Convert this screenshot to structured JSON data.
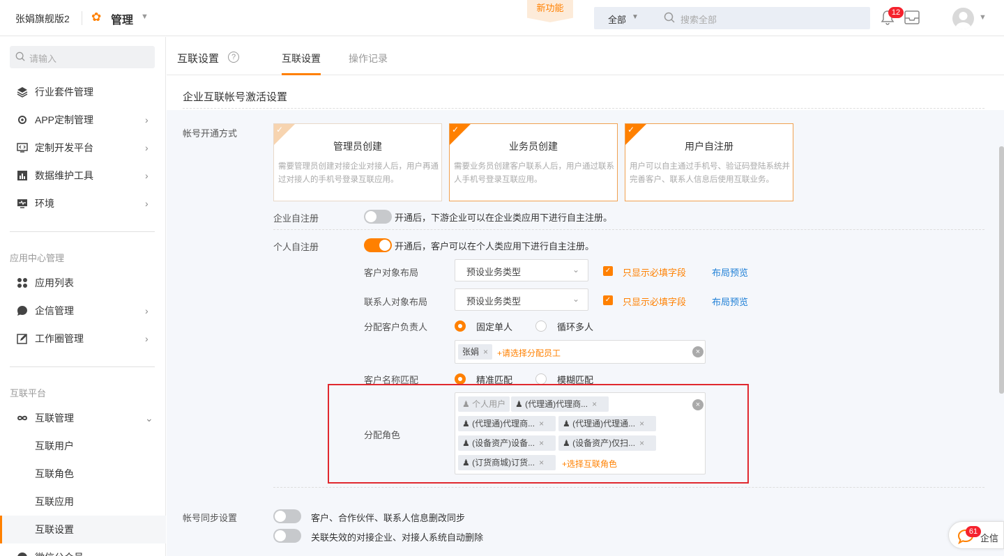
{
  "topbar": {
    "company": "张娟旗舰版2",
    "module": "管理",
    "new_feature": "新功能",
    "search_scope": "全部",
    "search_placeholder": "搜索全部",
    "bell_count": "12"
  },
  "sidebar": {
    "search_placeholder": "请输入",
    "items": [
      {
        "label": "行业套件管理",
        "icon": "layers-icon"
      },
      {
        "label": "APP定制管理",
        "icon": "app-gear-icon"
      },
      {
        "label": "定制开发平台",
        "icon": "code-icon"
      },
      {
        "label": "数据维护工具",
        "icon": "bar-chart-icon"
      },
      {
        "label": "环境",
        "icon": "monitor-icon"
      }
    ],
    "group_app": "应用中心管理",
    "app_items": [
      {
        "label": "应用列表",
        "icon": "grid-icon"
      },
      {
        "label": "企信管理",
        "icon": "chat-icon"
      },
      {
        "label": "工作圈管理",
        "icon": "edit-icon"
      }
    ],
    "group_link": "互联平台",
    "link_parent": "互联管理",
    "link_children": [
      "互联用户",
      "互联角色",
      "互联应用",
      "互联设置"
    ],
    "cutoff_item": "微信公众号"
  },
  "content": {
    "page_title": "互联设置",
    "tabs": [
      "互联设置",
      "操作记录"
    ],
    "section_title": "企业互联帐号激活设置",
    "account_mode_label": "帐号开通方式",
    "cards": [
      {
        "title": "管理员创建",
        "desc": "需要管理员创建对接企业对接人后，用户再通过对接人的手机号登录互联应用。",
        "checked": false
      },
      {
        "title": "业务员创建",
        "desc": "需要业务员创建客户联系人后，用户通过联系人手机号登录互联应用。",
        "checked": true
      },
      {
        "title": "用户自注册",
        "desc": "用户可以自主通过手机号、验证码登陆系统并完善客户、联系人信息后使用互联业务。",
        "checked": true
      }
    ],
    "ent_self_reg": {
      "label": "企业自注册",
      "text": "开通后，下游企业可以在企业类应用下进行自主注册。",
      "on": false
    },
    "personal_self_reg": {
      "label": "个人自注册",
      "text": "开通后，客户可以在个人类应用下进行自主注册。",
      "on": true
    },
    "customer_layout": {
      "label": "客户对象布局",
      "value": "预设业务类型",
      "check": "只显示必填字段",
      "link": "布局预览"
    },
    "contact_layout": {
      "label": "联系人对象布局",
      "value": "预设业务类型",
      "check": "只显示必填字段",
      "link": "布局预览"
    },
    "owner": {
      "label": "分配客户负责人",
      "options": [
        "固定单人",
        "循环多人"
      ],
      "selected": 0,
      "tag": "张娟",
      "add": "+请选择分配员工"
    },
    "name_match": {
      "label": "客户名称匹配",
      "options": [
        "精准匹配",
        "模糊匹配"
      ],
      "selected": 0
    },
    "roles": {
      "label": "分配角色",
      "tags": [
        "个人用户",
        "(代理通)代理商...",
        "(代理通)代理商...",
        "(代理通)代理通...",
        "(设备资产)设备...",
        "(设备资产)仅扫...",
        "(订货商城)订货..."
      ],
      "add": "+选择互联角色"
    },
    "sync_label": "帐号同步设置",
    "sync_items": [
      "客户、合作伙伴、联系人信息删改同步",
      "关联失效的对接企业、对接人系统自动删除"
    ]
  },
  "float": {
    "count": "61",
    "label": "企信"
  },
  "colors": {
    "accent": "#ff8000",
    "link": "#1e7fd6",
    "highlight": "#e0282e"
  }
}
